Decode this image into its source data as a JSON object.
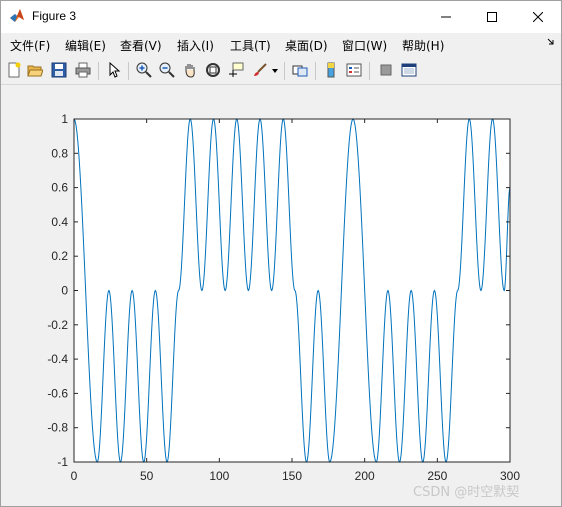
{
  "window": {
    "title": "Figure 3"
  },
  "menubar": {
    "items": [
      "文件(F)",
      "编辑(E)",
      "查看(V)",
      "插入(I)",
      "工具(T)",
      "桌面(D)",
      "窗口(W)",
      "帮助(H)"
    ]
  },
  "toolbar": {
    "icons": [
      "new-figure-icon",
      "open-icon",
      "save-icon",
      "print-icon",
      "pointer-icon",
      "zoom-in-icon",
      "zoom-out-icon",
      "pan-icon",
      "rotate-3d-icon",
      "data-cursor-icon",
      "brush-icon",
      "link-icon",
      "colorbar-icon",
      "legend-icon",
      "hide-plot-tools-icon",
      "show-plot-tools-icon"
    ]
  },
  "watermark": "CSDN @时空默契",
  "colors": {
    "line": "#0072bd",
    "axes_bg": "#ffffff",
    "figure_bg": "#f0f0f0"
  },
  "chart_data": {
    "type": "line",
    "xlim": [
      0,
      300
    ],
    "ylim": [
      -1,
      1
    ],
    "xticks": [
      0,
      50,
      100,
      150,
      200,
      250,
      300
    ],
    "yticks": [
      -1,
      -0.8,
      -0.6,
      -0.4,
      -0.2,
      0,
      0.2,
      0.4,
      0.6,
      0.8,
      1
    ],
    "xtick_labels": [
      "0",
      "50",
      "100",
      "150",
      "200",
      "250",
      "300"
    ],
    "ytick_labels": [
      "-1",
      "-0.8",
      "-0.6",
      "-0.4",
      "-0.2",
      "0",
      "0.2",
      "0.4",
      "0.6",
      "0.8",
      "1"
    ],
    "grid": false,
    "series": [
      {
        "x": [
          0,
          16,
          24,
          32,
          40,
          48,
          56,
          64,
          72,
          80,
          88,
          96,
          104,
          112,
          120,
          128,
          136,
          144,
          152,
          160,
          168,
          176,
          192,
          208,
          216,
          224,
          232,
          240,
          248,
          256,
          264,
          272,
          280,
          288,
          296,
          300
        ],
        "y": [
          1,
          -1,
          0,
          -1,
          0,
          -1,
          0,
          -1,
          0,
          1,
          0,
          1,
          0,
          1,
          0,
          1,
          0,
          1,
          0,
          -1,
          0,
          -1,
          1,
          -1,
          0,
          -1,
          0,
          -1,
          0,
          -1,
          0,
          1,
          0,
          1,
          0,
          0.6
        ]
      }
    ]
  }
}
